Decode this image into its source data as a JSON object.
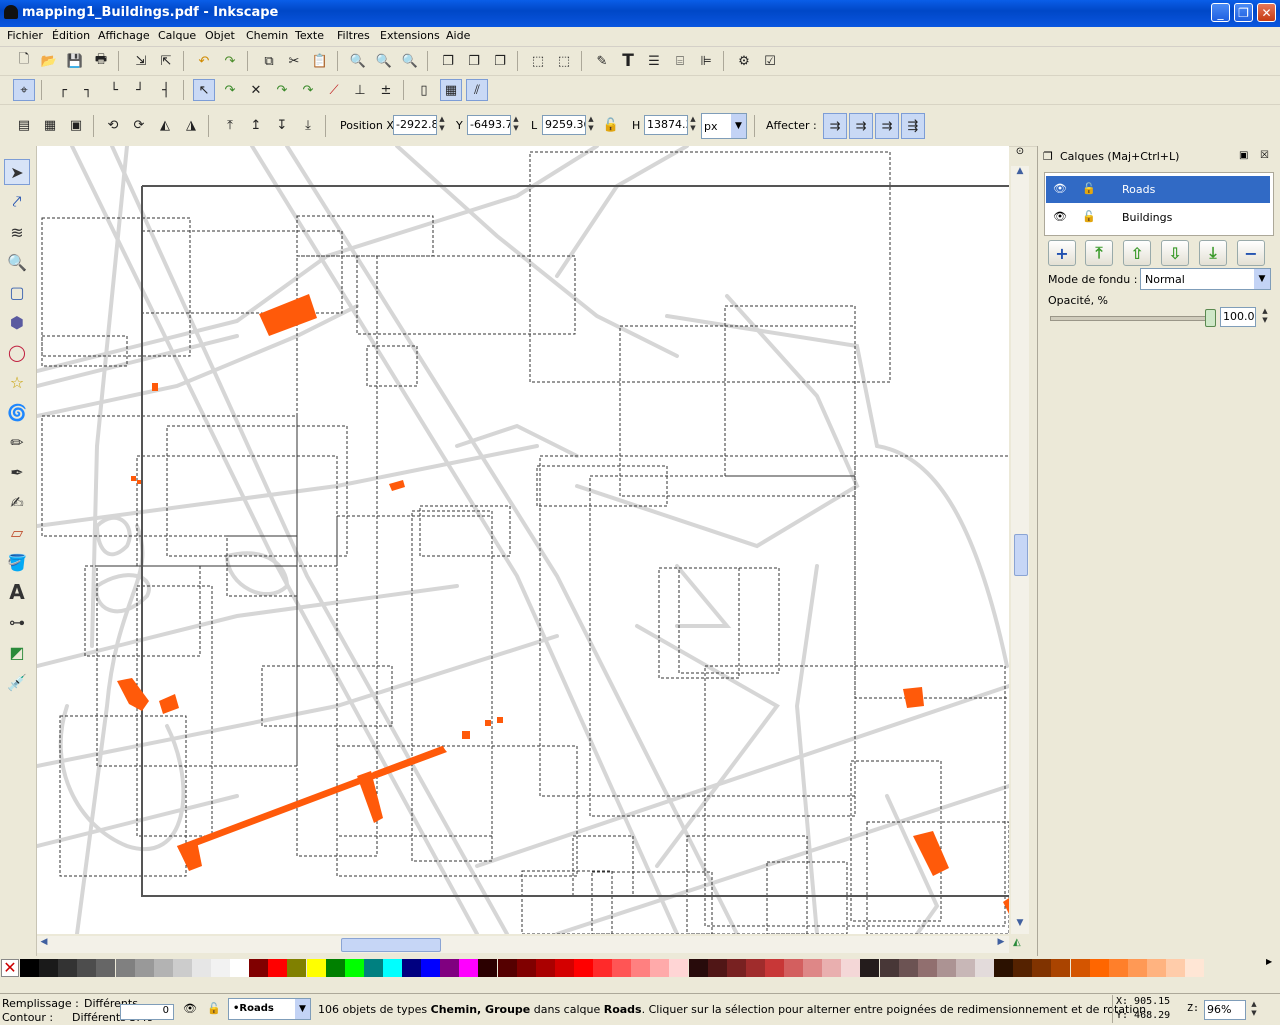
{
  "window": {
    "title": "mapping1_Buildings.pdf - Inkscape",
    "min": "_",
    "max": "❐",
    "close": "✕"
  },
  "menu": [
    "Fichier",
    "Édition",
    "Affichage",
    "Calque",
    "Objet",
    "Chemin",
    "Texte",
    "Filtres",
    "Extensions",
    "Aide"
  ],
  "selectbar": {
    "x_label": "Position X",
    "x_value": "-2922.8",
    "y_label": "Y",
    "y_value": "-6493.7",
    "w_label": "L",
    "w_value": "9259.36",
    "h_label": "H",
    "h_value": "13874.3",
    "unit": "px",
    "affect_label": "Affecter :"
  },
  "layers_panel": {
    "title": "Calques (Maj+Ctrl+L)",
    "layers": [
      {
        "name": "Roads",
        "selected": true
      },
      {
        "name": "Buildings",
        "selected": false
      }
    ],
    "blend_label": "Mode de fondu :",
    "blend_value": "Normal",
    "opacity_label": "Opacité, %",
    "opacity_value": "100.0"
  },
  "status": {
    "fill_label": "Remplissage :",
    "fill_value": "Différents",
    "stroke_label": "Contour :",
    "stroke_value": "Différents 3.49",
    "opacity_field": "0",
    "layer": "•Roads",
    "message_pre": "106 objets de types ",
    "message_bold1": "Chemin, Groupe",
    "message_mid": " dans calque ",
    "message_bold2": "Roads",
    "message_post": ". Cliquer sur la sélection pour alterner entre poignées de redimensionnement et de rotation.",
    "x_coord": "X:  905.15",
    "y_coord": "Y:  468.29",
    "zoom_label": "Z:",
    "zoom_value": "96%"
  },
  "colors": {
    "building": "#ff5a0a",
    "road": "#d4d4d4",
    "selected_layer": "#316ac5"
  },
  "palette": [
    "#000000",
    "#1a1a1a",
    "#333333",
    "#4d4d4d",
    "#666666",
    "#808080",
    "#999999",
    "#b3b3b3",
    "#cccccc",
    "#e6e6e6",
    "#f2f2f2",
    "#ffffff",
    "#800000",
    "#ff0000",
    "#808000",
    "#ffff00",
    "#008000",
    "#00ff00",
    "#008080",
    "#00ffff",
    "#000080",
    "#0000ff",
    "#800080",
    "#ff00ff",
    "#2b0000",
    "#550000",
    "#800000",
    "#aa0000",
    "#d40000",
    "#ff0000",
    "#ff2a2a",
    "#ff5555",
    "#ff8080",
    "#ffaaaa",
    "#ffd5d5",
    "#280b0b",
    "#501616",
    "#782121",
    "#a02c2c",
    "#c83737",
    "#d35f5f",
    "#de8787",
    "#e9afaf",
    "#f4d7d7",
    "#241c1c",
    "#483737",
    "#6c5353",
    "#916f6f",
    "#ac9393",
    "#c8b7b7",
    "#e3dbdb",
    "#2b1100",
    "#552200",
    "#803300",
    "#aa4400",
    "#d45500",
    "#ff6600",
    "#ff7f2a",
    "#ff9955",
    "#ffb380",
    "#ffccaa",
    "#ffe6d5"
  ]
}
